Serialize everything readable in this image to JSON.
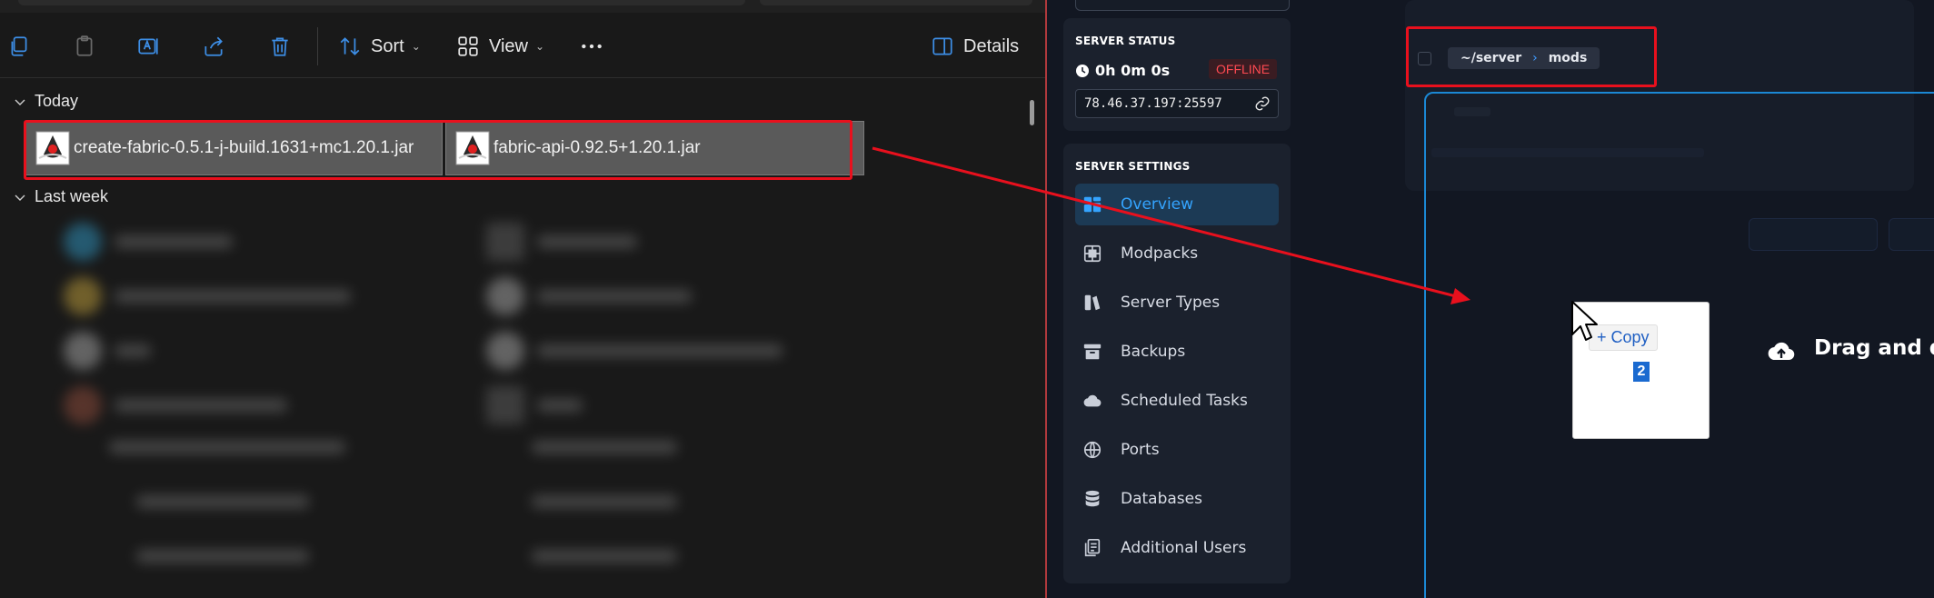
{
  "explorer": {
    "toolbar": {
      "sort_label": "Sort",
      "view_label": "View",
      "details_label": "Details",
      "icons": [
        "copy-icon",
        "paste-icon",
        "rename-icon",
        "share-icon",
        "delete-icon",
        "sort-icon",
        "view-icon",
        "more-icon",
        "details-icon"
      ]
    },
    "groups": {
      "today": "Today",
      "last_week": "Last week"
    },
    "selected_files": [
      "create-fabric-0.5.1-j-build.1631+mc1.20.1.jar",
      "fabric-api-0.92.5+1.20.1.jar"
    ]
  },
  "server_panel": {
    "status": {
      "title": "SERVER STATUS",
      "uptime": "0h 0m 0s",
      "badge": "OFFLINE",
      "address": "78.46.37.197:25597"
    },
    "settings": {
      "title": "SERVER SETTINGS",
      "items": [
        {
          "label": "Overview",
          "icon": "overview-icon",
          "active": true
        },
        {
          "label": "Modpacks",
          "icon": "modpacks-icon",
          "active": false
        },
        {
          "label": "Server Types",
          "icon": "server-types-icon",
          "active": false
        },
        {
          "label": "Backups",
          "icon": "backups-icon",
          "active": false
        },
        {
          "label": "Scheduled Tasks",
          "icon": "cloud-icon",
          "active": false
        },
        {
          "label": "Ports",
          "icon": "globe-icon",
          "active": false
        },
        {
          "label": "Databases",
          "icon": "database-icon",
          "active": false
        },
        {
          "label": "Additional Users",
          "icon": "users-icon",
          "active": false
        }
      ]
    }
  },
  "file_manager": {
    "breadcrumb": [
      "~/server",
      "mods"
    ],
    "drop_text": "Drag and d"
  },
  "drag_ghost": {
    "copy_label": "+ Copy",
    "count": "2"
  },
  "colors": {
    "annotation_red": "#e8101d",
    "accent_blue": "#34a4ff",
    "offline_red": "#ff4a52"
  }
}
